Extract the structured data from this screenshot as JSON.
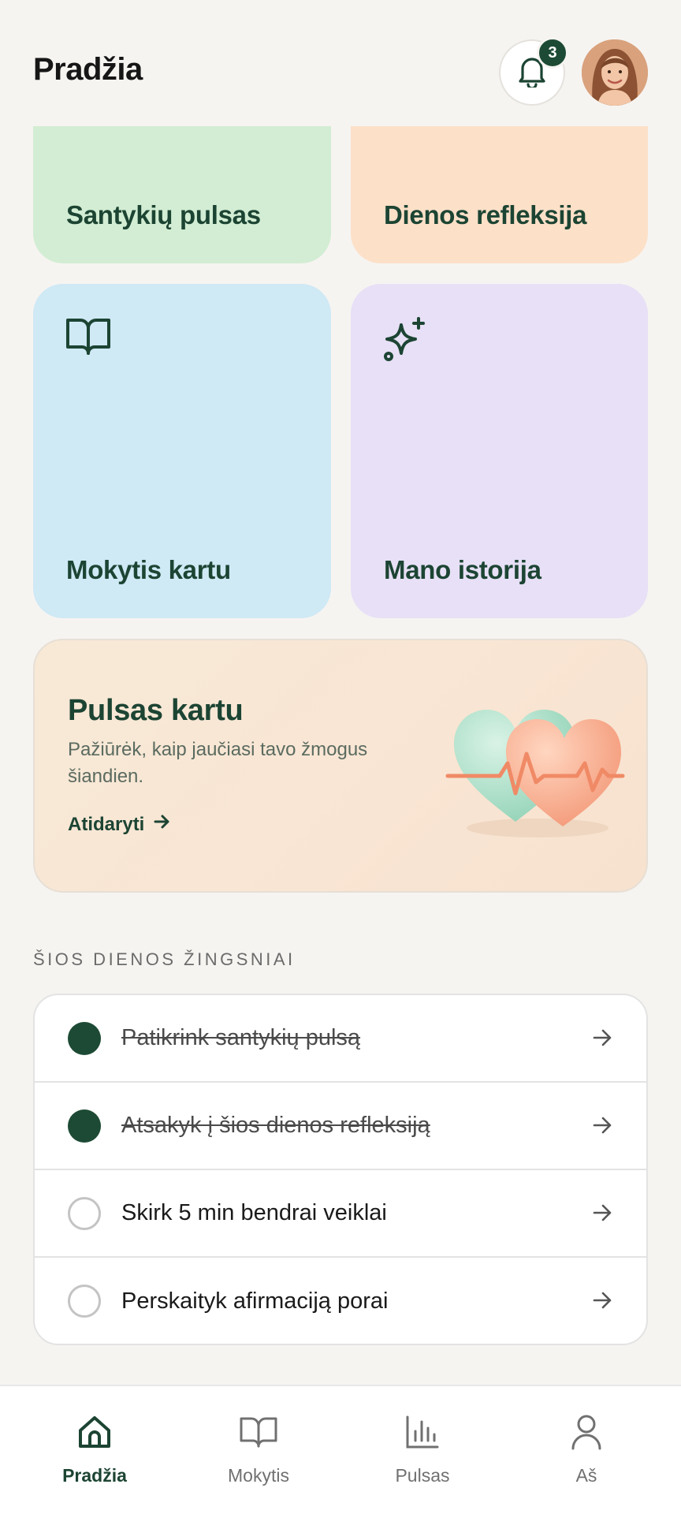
{
  "header": {
    "title": "Pradžia",
    "notification_count": "3",
    "icons": {
      "bell": "bell-icon",
      "avatar": "user-avatar"
    }
  },
  "tiles": [
    {
      "label": "Santykių pulsas",
      "color": "#d2edd3"
    },
    {
      "label": "Dienos refleksija",
      "color": "#fce0c8"
    },
    {
      "label": "Mokytis kartu",
      "color": "#cfe9f5",
      "icon": "open-book-icon"
    },
    {
      "label": "Mano istorija",
      "color": "#e7e0f6",
      "icon": "sparkles-icon"
    }
  ],
  "promo": {
    "title": "Pulsas kartu",
    "description": "Pažiūrėk, kaip jaučiasi tavo žmogus šiandien.",
    "link_label": "Atidaryti",
    "image": "hearts-heartbeat-illustration"
  },
  "steps_section": {
    "heading": "ŠIOS DIENOS ŽINGSNIAI",
    "items": [
      {
        "label": "Patikrink santykių pulsą",
        "done": true
      },
      {
        "label": "Atsakyk į šios dienos refleksiją",
        "done": true
      },
      {
        "label": "Skirk 5 min bendrai veiklai",
        "done": false
      },
      {
        "label": "Perskaityk afirmaciją porai",
        "done": false
      }
    ]
  },
  "bottom_nav": [
    {
      "label": "Pradžia",
      "icon": "home-icon",
      "active": true
    },
    {
      "label": "Mokytis",
      "icon": "book-icon",
      "active": false
    },
    {
      "label": "Pulsas",
      "icon": "bar-chart-icon",
      "active": false
    },
    {
      "label": "Aš",
      "icon": "person-icon",
      "active": false
    }
  ],
  "colors": {
    "accent": "#1d4a34",
    "background": "#f6f4f1"
  }
}
